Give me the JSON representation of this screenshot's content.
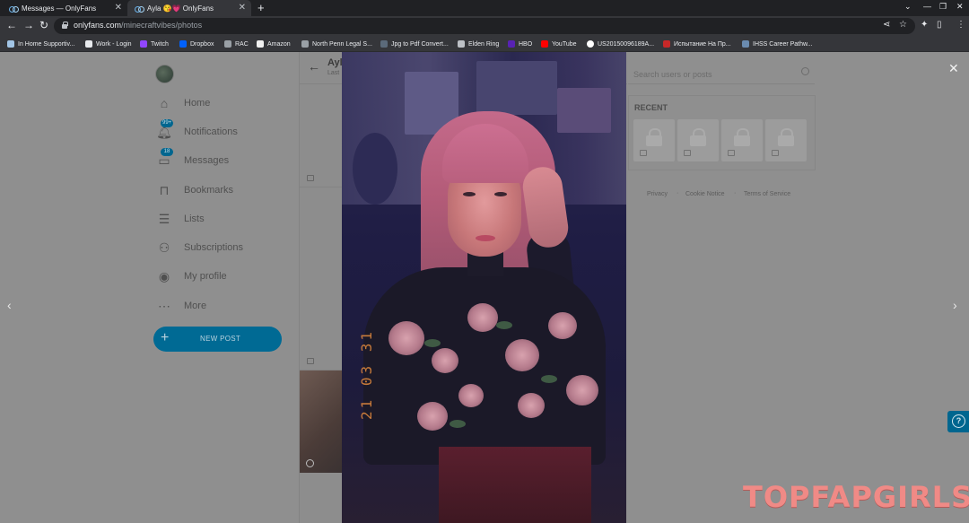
{
  "browser": {
    "tabs": [
      {
        "title": "Messages — OnlyFans",
        "active": false
      },
      {
        "title": "Ayla 😘💗 OnlyFans",
        "active": true
      }
    ],
    "url_host": "onlyfans.com",
    "url_path": "/minecraftvibes/photos",
    "bookmarks": [
      {
        "label": "In Home Supportiv...",
        "icon": "folder-icon"
      },
      {
        "label": "Work - Login",
        "icon": "folder-icon"
      },
      {
        "label": "Twitch",
        "icon": "twitch-icon"
      },
      {
        "label": "Dropbox",
        "icon": "dropbox-icon"
      },
      {
        "label": "RAC",
        "icon": "rac-icon"
      },
      {
        "label": "Amazon",
        "icon": "amazon-icon"
      },
      {
        "label": "North Penn Legal S...",
        "icon": "link-icon"
      },
      {
        "label": "Jpg to Pdf Convert...",
        "icon": "link-icon"
      },
      {
        "label": "Elden Ring",
        "icon": "folder-icon"
      },
      {
        "label": "HBO",
        "icon": "hbo-icon"
      },
      {
        "label": "YouTube",
        "icon": "youtube-icon"
      },
      {
        "label": "US20150096189A...",
        "icon": "google-icon"
      },
      {
        "label": "Испытание На Пр...",
        "icon": "shield-icon"
      },
      {
        "label": "IHSS Career Pathw...",
        "icon": "link-icon"
      }
    ]
  },
  "sidebar": {
    "items": [
      {
        "label": "Home",
        "icon": "home-icon"
      },
      {
        "label": "Notifications",
        "icon": "bell-icon",
        "badge": "99+"
      },
      {
        "label": "Messages",
        "icon": "message-icon",
        "badge": "18"
      },
      {
        "label": "Bookmarks",
        "icon": "bookmark-icon"
      },
      {
        "label": "Lists",
        "icon": "list-icon"
      },
      {
        "label": "Subscriptions",
        "icon": "subscriptions-icon"
      },
      {
        "label": "My profile",
        "icon": "profile-icon"
      },
      {
        "label": "More",
        "icon": "more-icon"
      }
    ],
    "new_post": "NEW POST"
  },
  "feed": {
    "name": "Ayla",
    "subtitle": "Last"
  },
  "right": {
    "search_placeholder": "Search users or posts",
    "recent_title": "RECENT",
    "footer": [
      "Privacy",
      "Cookie Notice",
      "Terms of Service"
    ]
  },
  "photo": {
    "date_stamp": "21 03 31"
  },
  "watermark": "TOPFAPGIRLS"
}
